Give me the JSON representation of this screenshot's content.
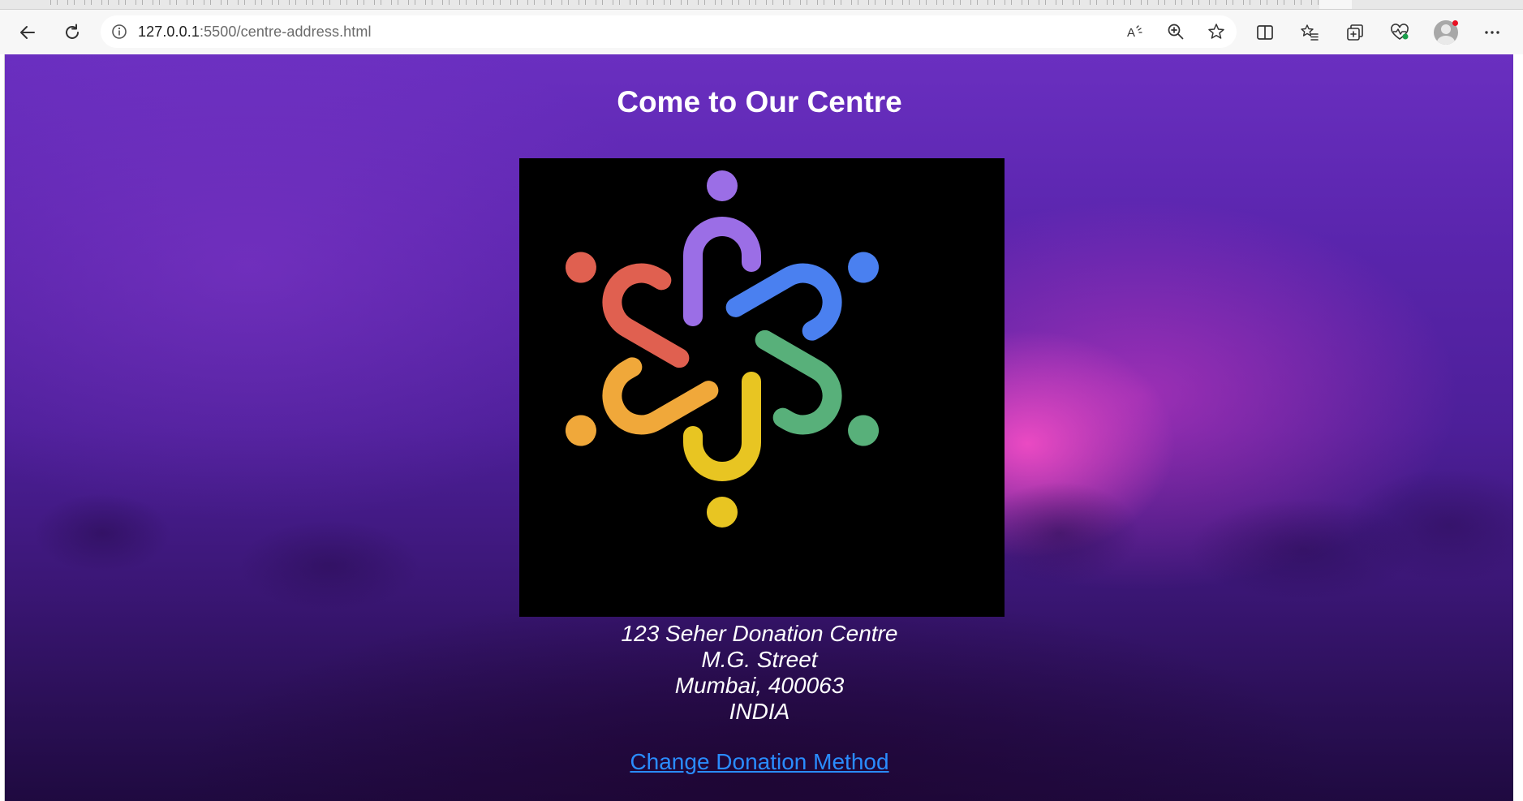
{
  "browser": {
    "url_host": "127.0.0.1",
    "url_rest": ":5500/centre-address.html",
    "icons": {
      "back": "arrow-left-icon",
      "reload": "reload-icon",
      "site_info": "info-icon",
      "read_aloud": "read-aloud-icon",
      "zoom": "zoom-icon",
      "favorite": "star-icon",
      "split": "split-screen-icon",
      "favorites": "favorites-icon",
      "collections": "collections-icon",
      "performance": "heart-pulse-icon",
      "profile": "avatar",
      "more": "more-icon"
    }
  },
  "page": {
    "title": "Come to Our Centre",
    "logo": {
      "colors": [
        "#9b6ee6",
        "#4a80f0",
        "#58b07a",
        "#e8c522",
        "#f0a83a",
        "#e06050"
      ]
    },
    "address": {
      "line1": "123 Seher Donation Centre",
      "line2": "M.G. Street",
      "line3": "Mumbai, 400063",
      "line4": "INDIA"
    },
    "change_link": "Change Donation Method",
    "colors": {
      "background_top": "#6a2fc0",
      "background_bottom": "#1f0a40",
      "glow": "#ff50c8",
      "text": "#ffffff",
      "link": "#2a8cff"
    }
  }
}
